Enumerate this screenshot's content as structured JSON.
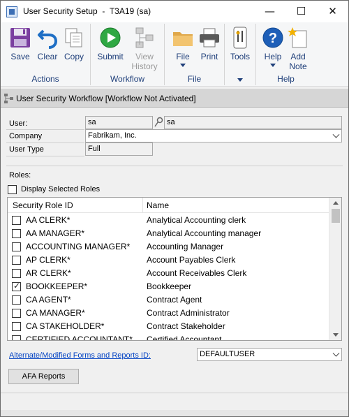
{
  "window": {
    "title": "User Security Setup  -  T3A19 (sa)",
    "minimize_glyph": "—",
    "maximize_glyph": "☐",
    "close_glyph": "✕"
  },
  "ribbon": {
    "groups": {
      "actions": "Actions",
      "workflow": "Workflow",
      "file": "File",
      "tools_group": "",
      "help": "Help"
    },
    "buttons": {
      "save": "Save",
      "clear": "Clear",
      "copy": "Copy",
      "submit": "Submit",
      "view_history_1": "View",
      "view_history_2": "History",
      "file": "File",
      "print": "Print",
      "tools": "Tools",
      "help": "Help",
      "add_note_1": "Add",
      "add_note_2": "Note"
    },
    "icons": {
      "save": "floppy-disk-icon",
      "clear": "undo-arrow-icon",
      "copy": "copy-documents-icon",
      "submit": "play-submit-icon",
      "view_history": "workflow-history-icon",
      "file": "folder-icon",
      "print": "printer-icon",
      "tools": "tools-icon",
      "help": "help-question-icon",
      "add_note": "note-star-icon"
    }
  },
  "workflow_bar": {
    "text": "User Security Workflow [Workflow Not Activated]"
  },
  "form": {
    "user_label": "User:",
    "user_id": "sa",
    "user_name": "sa",
    "company_label": "Company",
    "company_value": "Fabrikam, Inc.",
    "user_type_label": "User Type",
    "user_type_value": "Full",
    "roles_label": "Roles:",
    "display_selected_label": "Display Selected Roles",
    "display_selected_checked": false
  },
  "roles_table": {
    "columns": [
      "Security Role ID",
      "Name"
    ],
    "rows": [
      {
        "id": "AA CLERK*",
        "name": "Analytical Accounting clerk",
        "checked": false
      },
      {
        "id": "AA MANAGER*",
        "name": "Analytical Accounting manager",
        "checked": false
      },
      {
        "id": "ACCOUNTING MANAGER*",
        "name": "Accounting Manager",
        "checked": false
      },
      {
        "id": "AP CLERK*",
        "name": "Account Payables Clerk",
        "checked": false
      },
      {
        "id": "AR CLERK*",
        "name": "Account Receivables Clerk",
        "checked": false
      },
      {
        "id": "BOOKKEEPER*",
        "name": "Bookkeeper",
        "checked": true
      },
      {
        "id": "CA AGENT*",
        "name": "Contract Agent",
        "checked": false
      },
      {
        "id": "CA MANAGER*",
        "name": "Contract Administrator",
        "checked": false
      },
      {
        "id": "CA STAKEHOLDER*",
        "name": "Contract Stakeholder",
        "checked": false
      },
      {
        "id": "CERTIFIED ACCOUNTANT*",
        "name": "Certified Accountant",
        "checked": false
      }
    ]
  },
  "footer": {
    "afa_link": "Alternate/Modified Forms and Reports ID:",
    "afa_value": "DEFAULTUSER",
    "afa_button": "AFA Reports"
  }
}
